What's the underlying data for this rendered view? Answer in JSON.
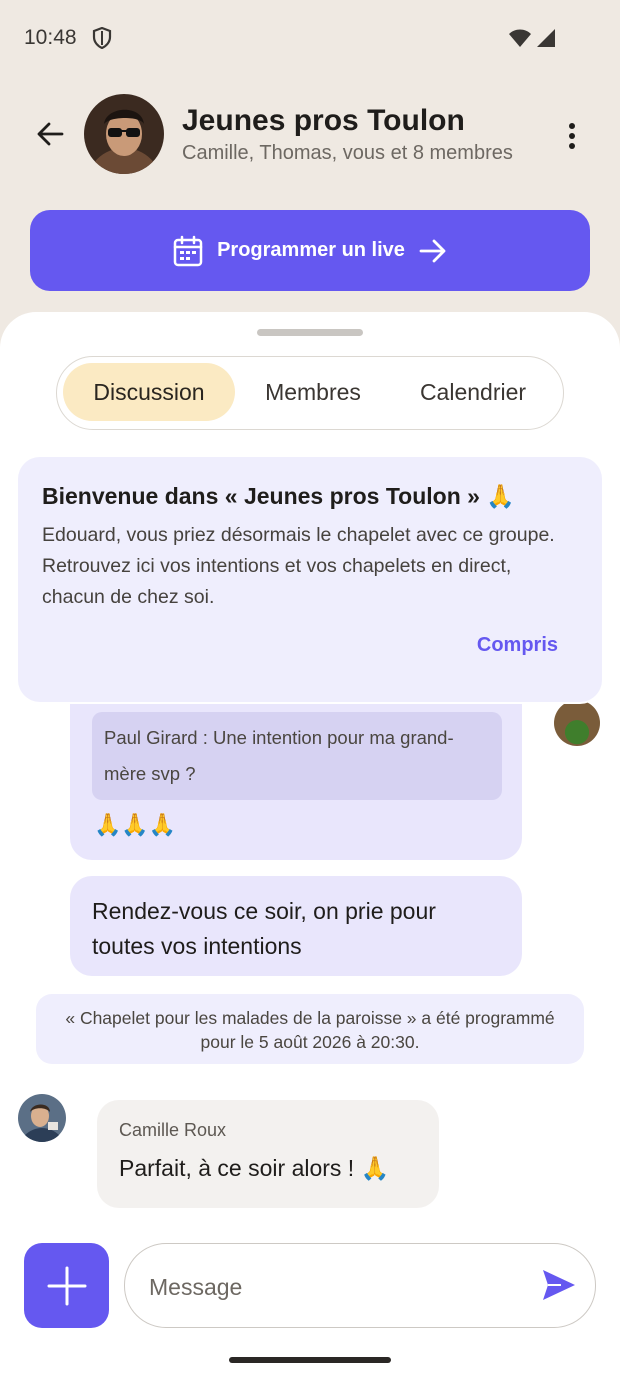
{
  "status_bar": {
    "time": "10:48"
  },
  "header": {
    "title": "Jeunes pros Toulon",
    "subtitle": "Camille, Thomas, vous et 8 membres"
  },
  "live_button": {
    "label": "Programmer un live"
  },
  "tabs": [
    {
      "label": "Discussion",
      "active": true
    },
    {
      "label": "Membres",
      "active": false
    },
    {
      "label": "Calendrier",
      "active": false
    }
  ],
  "welcome": {
    "title": "Bienvenue dans « Jeunes pros Toulon » 🙏",
    "body": "Edouard, vous priez désormais le chapelet avec ce groupe. Retrouvez ici vos intentions et vos chapelets en direct, chacun de chez soi.",
    "action": "Compris"
  },
  "messages": [
    {
      "quote": "Paul Girard : Une intention pour ma grand-mère svp ?",
      "text": "🙏🙏🙏"
    },
    {
      "text": "Rendez-vous ce soir, on prie pour toutes vos intentions"
    },
    {
      "system": "« Chapelet pour les malades de la paroisse » a été programmé pour le 5 août 2026 à 20:30."
    },
    {
      "sender": "Camille Roux",
      "text": "Parfait, à ce soir alors ! 🙏"
    }
  ],
  "composer": {
    "placeholder": "Message"
  },
  "colors": {
    "accent": "#6558f0",
    "active_tab": "#fbeac3",
    "bubble": "#e9e6fc",
    "background": "#efe9e2"
  }
}
